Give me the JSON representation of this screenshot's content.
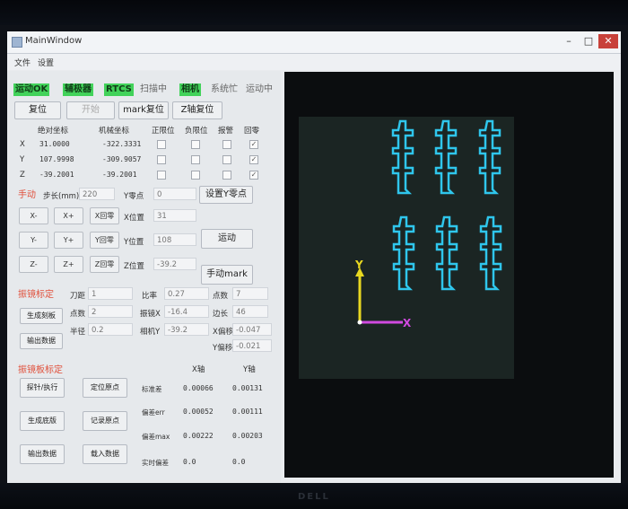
{
  "window": {
    "title": "MainWindow",
    "min": "–",
    "max": "□",
    "close": "✕"
  },
  "menu": {
    "file": "文件",
    "settings": "设置"
  },
  "status": {
    "motion_ok": "运动OK",
    "galvo": "辅极器",
    "rtc": "RTCS",
    "scanning": "扫描中",
    "camera": "相机",
    "system_busy": "系统忙",
    "running": "运动中"
  },
  "toolbar": {
    "reset": "复位",
    "start": "开始",
    "mark_reset": "mark复位",
    "z_reset": "Z轴复位"
  },
  "axis_table": {
    "headers": [
      "绝对坐标",
      "机械坐标",
      "正限位",
      "负限位",
      "报警",
      "回零"
    ],
    "rows": [
      {
        "axis": "X",
        "abs": "31.0000",
        "mech": "-322.3331",
        "home": "✓"
      },
      {
        "axis": "Y",
        "abs": "107.9998",
        "mech": "-309.9057",
        "home": "✓"
      },
      {
        "axis": "Z",
        "abs": "-39.2001",
        "mech": "-39.2001",
        "home": "✓"
      }
    ]
  },
  "manual": {
    "section": "手动",
    "step_label": "步长(mm)",
    "step_value": "220",
    "ypoint_label": "Y零点",
    "ypoint_value": "0",
    "set_y_zero": "设置Y零点",
    "rows": [
      {
        "minus": "X-",
        "plus": "X+",
        "home": "X回零",
        "pos_label": "X位置",
        "pos_value": "31"
      },
      {
        "minus": "Y-",
        "plus": "Y+",
        "home": "Y回零",
        "pos_label": "Y位置",
        "pos_value": "108"
      },
      {
        "minus": "Z-",
        "plus": "Z+",
        "home": "Z回零",
        "pos_label": "Z位置",
        "pos_value": "-39.2"
      }
    ],
    "move": "运动",
    "manual_mark": "手动mark"
  },
  "cal": {
    "section": "振镜标定",
    "knife_label": "刀距",
    "knife_value": "1",
    "scale_label": "比率",
    "scale_value": "0.27",
    "spacing_label": "点数",
    "spacing_value": "7",
    "points_label": "点数",
    "points_value": "2",
    "offset_label": "振镜X",
    "offset_value": "-16.4",
    "step_label2": "边长",
    "step_value2": "46",
    "radius_label": "半径",
    "radius_value": "0.2",
    "camy_label": "相机Y",
    "camy_value": "-39.2",
    "xshift_label": "X偏移",
    "xshift_value": "-0.047",
    "yshift_label": "Y偏移",
    "yshift_value": "-0.021",
    "gen_btn": "生成刻板",
    "export_btn": "输出数据"
  },
  "table_cal": {
    "section": "振镜板标定",
    "col_x": "X轴",
    "col_y": "Y轴",
    "btns": [
      "探针/执行",
      "定位原点",
      "生成底版",
      "记录原点",
      "输出数据",
      "载入数据"
    ],
    "rows": [
      {
        "label": "标准差",
        "x": "0.00066",
        "y": "0.00131"
      },
      {
        "label": "偏差err",
        "x": "0.00052",
        "y": "0.00111"
      },
      {
        "label": "偏差max",
        "x": "0.00222",
        "y": "0.00203"
      },
      {
        "label": "实时偏差",
        "x": "0.0",
        "y": "0.0"
      }
    ]
  },
  "canvas": {
    "axis_y": "Y",
    "axis_x": "X",
    "part_color": "#2fc6ec",
    "axis_y_color": "#e8d820",
    "axis_x_color": "#d04ae0"
  },
  "brand": "DELL"
}
